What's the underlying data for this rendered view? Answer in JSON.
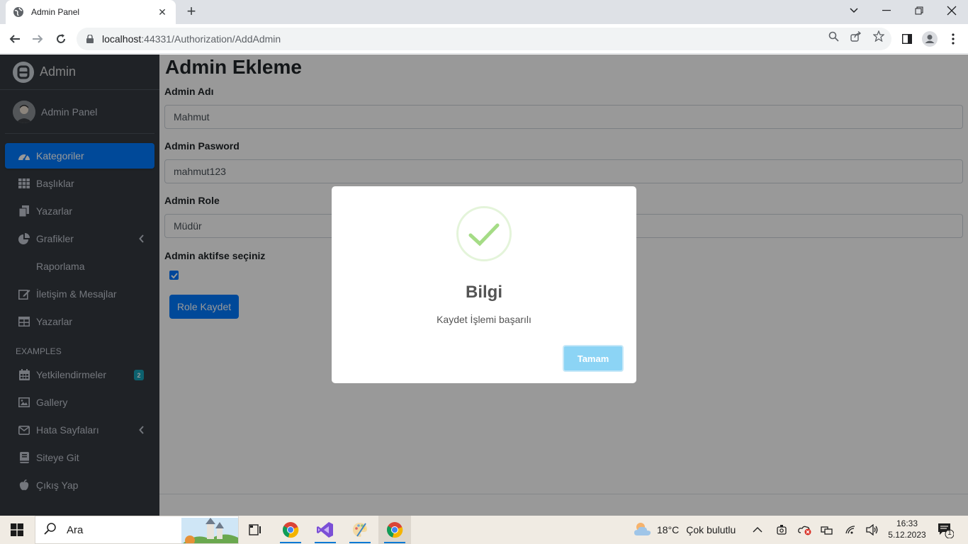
{
  "browser": {
    "tab_title": "Admin Panel",
    "url_host": "localhost",
    "url_rest": ":44331/Authorization/AddAdmin"
  },
  "sidebar": {
    "brand": "Admin",
    "user_name": "Admin Panel",
    "items": [
      {
        "label": "Kategoriler",
        "icon": "dashboard-icon",
        "active": true
      },
      {
        "label": "Başlıklar",
        "icon": "grid-icon"
      },
      {
        "label": "Yazarlar",
        "icon": "copy-icon"
      },
      {
        "label": "Grafikler",
        "icon": "pie-chart-icon",
        "caret": true
      },
      {
        "label": "Raporlama",
        "sub": true
      },
      {
        "label": "İletişim & Mesajlar",
        "icon": "edit-icon"
      },
      {
        "label": "Yazarlar",
        "icon": "table-icon"
      }
    ],
    "section_header": "EXAMPLES",
    "examples": [
      {
        "label": "Yetkilendirmeler",
        "icon": "calendar-icon",
        "badge": "2"
      },
      {
        "label": "Gallery",
        "icon": "image-icon"
      },
      {
        "label": "Hata Sayfaları",
        "icon": "envelope-icon",
        "caret": true
      },
      {
        "label": "Siteye Git",
        "icon": "book-icon"
      },
      {
        "label": "Çıkış Yap",
        "icon": "apple-icon"
      }
    ]
  },
  "form": {
    "title": "Admin Ekleme",
    "name_label": "Admin Adı",
    "name_value": "Mahmut",
    "password_label": "Admin Pasword",
    "password_value": "mahmut123",
    "role_label": "Admin Role",
    "role_value": "Müdür",
    "active_label": "Admin aktifse seçiniz",
    "active_checked": true,
    "submit_label": "Role Kaydet"
  },
  "modal": {
    "title": "Bilgi",
    "text": "Kaydet İşlemi başarılı",
    "confirm_label": "Tamam"
  },
  "taskbar": {
    "search_placeholder": "Ara",
    "weather_temp": "18°C",
    "weather_desc": "Çok bulutlu",
    "time": "16:33",
    "date": "5.12.2023",
    "notification_count": "1"
  },
  "colors": {
    "sidebar_bg": "#343a40",
    "primary": "#007bff",
    "success_check": "#a5dc86",
    "modal_button": "#8cd4f5"
  }
}
